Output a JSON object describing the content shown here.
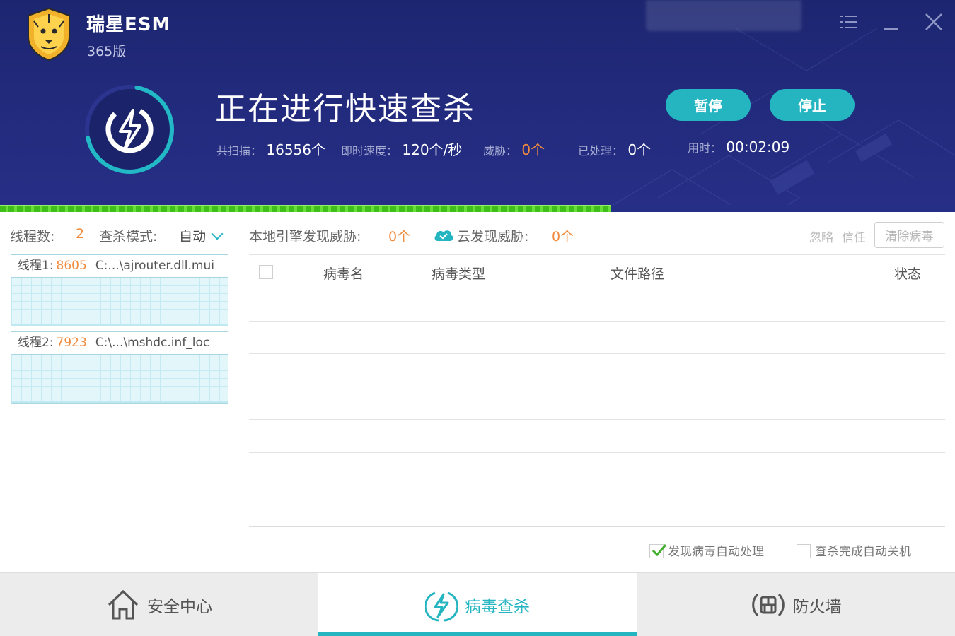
{
  "app": {
    "title": "瑞星ESM",
    "edition": "365版"
  },
  "window": {
    "user_badge": "",
    "menu_icon": "list-menu-icon",
    "minimize_icon": "minimize-icon",
    "close_icon": "close-icon"
  },
  "scan": {
    "title": "正在进行快速查杀",
    "pause_label": "暂停",
    "stop_label": "停止",
    "progress": 0.64,
    "stats": {
      "scanned_label": "共扫描：",
      "scanned_value": "16556个",
      "speed_label": "即时速度：",
      "speed_value": "120个/秒",
      "threats_label": "威胁：",
      "threats_value": "0个",
      "handled_label": "已处理：",
      "handled_value": "0个",
      "elapsed_label": "用时：",
      "elapsed_value": "00:02:09"
    }
  },
  "toolbar": {
    "threads_label": "线程数:",
    "threads_value": "2",
    "mode_label": "查杀模式:",
    "mode_value": "自动",
    "local_label": "本地引擎发现威胁:",
    "local_value": "0个",
    "cloud_label": "云发现威胁:",
    "cloud_value": "0个",
    "ignore_label": "忽略",
    "trust_label": "信任",
    "clean_label": "清除病毒"
  },
  "threads": [
    {
      "label": "线程1:",
      "count": "8605",
      "path": "C:...\\ajrouter.dll.mui"
    },
    {
      "label": "线程2:",
      "count": "7923",
      "path": "C:\\...\\mshdc.inf_loc"
    }
  ],
  "table": {
    "columns": [
      "病毒名",
      "病毒类型",
      "文件路径",
      "状态"
    ],
    "rows": []
  },
  "options": {
    "auto_handle_label": "发现病毒自动处理",
    "auto_handle_checked": true,
    "auto_shutdown_label": "查杀完成自动关机",
    "auto_shutdown_checked": false
  },
  "nav": {
    "tabs": [
      {
        "label": "安全中心",
        "icon": "house-icon"
      },
      {
        "label": "病毒查杀",
        "icon": "lightning-icon",
        "active": true
      },
      {
        "label": "防火墙",
        "icon": "firewall-icon"
      }
    ]
  },
  "colors": {
    "header_bg": "#222a7c",
    "accent": "#24b5c1",
    "warning": "#f08a3c",
    "progress": "#3fbf1c"
  }
}
